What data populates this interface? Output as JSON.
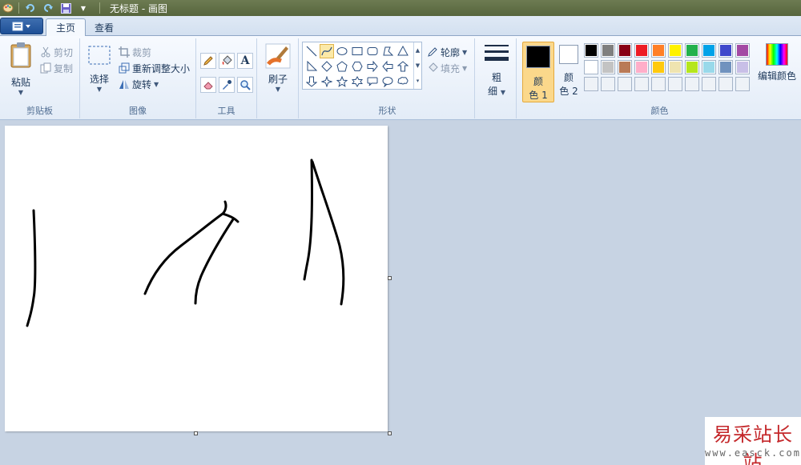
{
  "window": {
    "title": "无标题 - 画图"
  },
  "tabs": [
    {
      "label": "主页",
      "active": true
    },
    {
      "label": "查看",
      "active": false
    }
  ],
  "clipboard": {
    "paste": "粘贴",
    "cut": "剪切",
    "copy": "复制",
    "group": "剪贴板"
  },
  "image": {
    "select": "选择",
    "crop": "裁剪",
    "resize": "重新调整大小",
    "rotate": "旋转",
    "group": "图像"
  },
  "tools": {
    "group": "工具",
    "icons": [
      "pencil-icon",
      "fill-icon",
      "text-icon",
      "eraser-icon",
      "color-picker-icon",
      "magnifier-icon"
    ]
  },
  "brushes": {
    "label": "刷子"
  },
  "shapes": {
    "group": "形状",
    "outline": "轮廓",
    "fill": "填充",
    "items": [
      "line",
      "curve",
      "oval",
      "rectangle",
      "rounded-rectangle",
      "polygon",
      "triangle",
      "right-triangle",
      "diamond",
      "pentagon",
      "hexagon",
      "right-arrow",
      "left-arrow",
      "up-arrow",
      "down-arrow",
      "four-point-star",
      "five-point-star",
      "six-point-star",
      "rounded-callout",
      "oval-callout",
      "cloud-callout"
    ],
    "selected": "curve"
  },
  "size": {
    "label1": "粗",
    "label2": "细"
  },
  "colors": {
    "group": "颜色",
    "color1_label1": "颜",
    "color1_label2": "色 1",
    "color2_label1": "颜",
    "color2_label2": "色 2",
    "color1": "#000000",
    "color2": "#ffffff",
    "edit": "编辑颜色",
    "palette_row1": [
      "#000000",
      "#7f7f7f",
      "#880015",
      "#ed1c24",
      "#ff7f27",
      "#fff200",
      "#22b14c",
      "#00a2e8",
      "#3f48cc",
      "#a349a4"
    ],
    "palette_row2": [
      "#ffffff",
      "#c3c3c3",
      "#b97a57",
      "#ffaec9",
      "#ffc90e",
      "#efe4b0",
      "#b5e61d",
      "#99d9ea",
      "#7092be",
      "#c8bfe7"
    ]
  },
  "watermark": {
    "main": "易采站长站",
    "sub": "www.easck.com"
  }
}
